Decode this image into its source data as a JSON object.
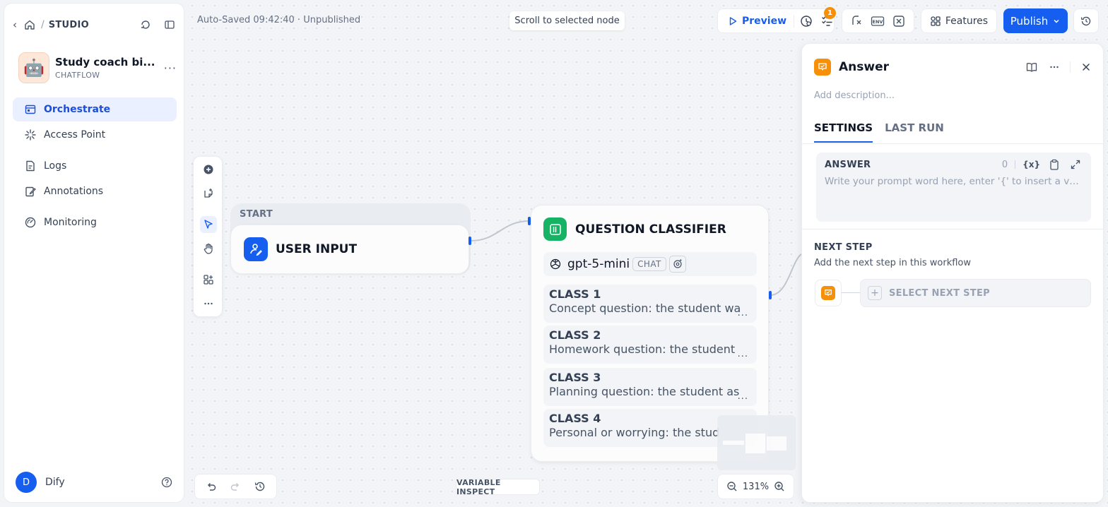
{
  "sidebar": {
    "breadcrumb_root": "STUDIO",
    "app": {
      "name": "Study coach bi...",
      "type": "CHATFLOW",
      "avatar": "🤖"
    },
    "nav": [
      {
        "label": "Orchestrate",
        "icon": "orchestrate-icon",
        "active": true
      },
      {
        "label": "Access Point",
        "icon": "access-point-icon",
        "active": false
      },
      {
        "label": "Logs",
        "icon": "logs-icon",
        "active": false
      },
      {
        "label": "Annotations",
        "icon": "annotations-icon",
        "active": false
      },
      {
        "label": "Monitoring",
        "icon": "monitoring-icon",
        "active": false
      }
    ],
    "user": {
      "initial": "D",
      "name": "Dify"
    }
  },
  "topbar": {
    "autosave": "Auto-Saved 09:42:40 · Unpublished",
    "scroll_to_node": "Scroll to selected node",
    "preview_label": "Preview",
    "checklist_badge": "1",
    "features_label": "Features",
    "publish_label": "Publish"
  },
  "canvas": {
    "start_node": {
      "header": "START",
      "title": "USER INPUT"
    },
    "classifier_node": {
      "title": "QUESTION CLASSIFIER",
      "model": "gpt-5-mini",
      "model_mode": "CHAT",
      "classes": [
        {
          "name": "CLASS 1",
          "desc": "Concept question: the student wa",
          "more": "..."
        },
        {
          "name": "CLASS 2",
          "desc": "Homework question: the student",
          "more": "..."
        },
        {
          "name": "CLASS 3",
          "desc": "Planning question: the student as",
          "more": "..."
        },
        {
          "name": "CLASS 4",
          "desc": "Personal or worrying: the stud",
          "more": ""
        }
      ]
    },
    "variable_inspect": "VARIABLE INSPECT",
    "zoom": "131%"
  },
  "panel": {
    "title": "Answer",
    "description_placeholder": "Add description...",
    "tabs": [
      "SETTINGS",
      "LAST RUN"
    ],
    "answer": {
      "label": "ANSWER",
      "count": "0",
      "var_button": "{x}",
      "placeholder": "Write your prompt word here, enter '{' to insert a vari..."
    },
    "next_step": {
      "title": "NEXT STEP",
      "subtitle": "Add the next step in this workflow",
      "button": "SELECT NEXT STEP"
    }
  },
  "colors": {
    "accent": "#155eef",
    "answer_node": "#f79009",
    "classifier_node": "#16b364",
    "badge": "#f79009"
  }
}
